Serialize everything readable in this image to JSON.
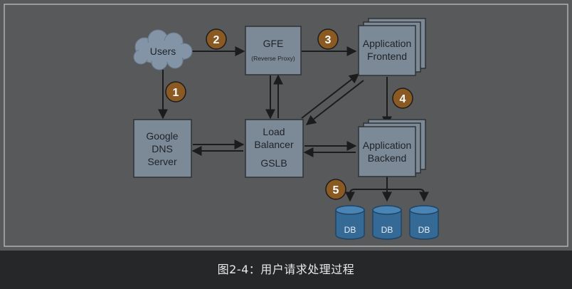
{
  "diagram": {
    "nodes": {
      "users": {
        "label": "Users"
      },
      "gfe": {
        "label": "GFE",
        "sublabel": "(Reverse Proxy)"
      },
      "app_frontend": {
        "line1": "Application",
        "line2": "Frontend"
      },
      "google_dns": {
        "line1": "Google",
        "line2": "DNS",
        "line3": "Server"
      },
      "load_balancer": {
        "line1": "Load",
        "line2": "Balancer",
        "line3": "GSLB"
      },
      "app_backend": {
        "line1": "Application",
        "line2": "Backend"
      },
      "databases": [
        {
          "label": "DB"
        },
        {
          "label": "DB"
        },
        {
          "label": "DB"
        }
      ]
    },
    "steps": [
      "1",
      "2",
      "3",
      "4",
      "5"
    ]
  },
  "caption": "图2-4：用户请求处理过程",
  "colors": {
    "panel_background": "#58595b",
    "panel_border": "#aeb0b2",
    "node_fill": "#7c8a97",
    "node_stroke": "#2f3236",
    "cloud_fill": "#8394a6",
    "step_fill": "#8a5a22",
    "db_fill": "#356a97",
    "arrow": "#1c1c1c",
    "caption_bar": "#252729"
  }
}
